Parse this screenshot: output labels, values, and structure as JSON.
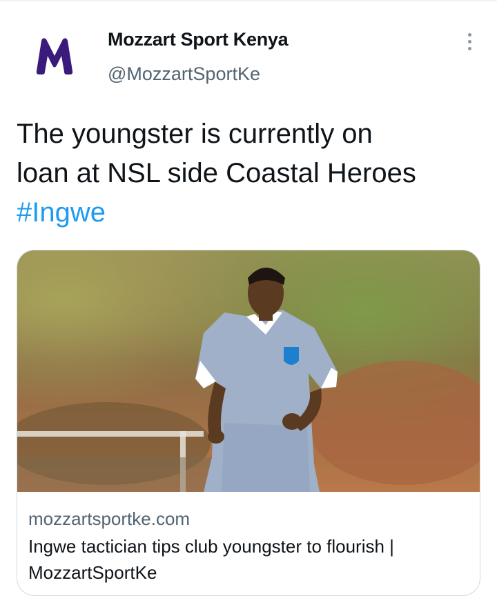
{
  "tweet": {
    "author": {
      "name": "Mozzart Sport Kenya",
      "handle": "@MozzartSportKe",
      "avatar_letter": "M",
      "avatar_color": "#3a1a7a"
    },
    "more_icon": "more-vertical-icon",
    "text_lines": [
      "The youngster is currently on",
      "loan at NSL side Coastal Heroes"
    ],
    "hashtag": "#Ingwe",
    "hashtag_color": "#1d9bf0"
  },
  "card": {
    "image_alt": "player-photo",
    "domain": "mozzartsportke.com",
    "title": "Ingwe tactician tips club youngster to flourish | MozzartSportKe"
  }
}
